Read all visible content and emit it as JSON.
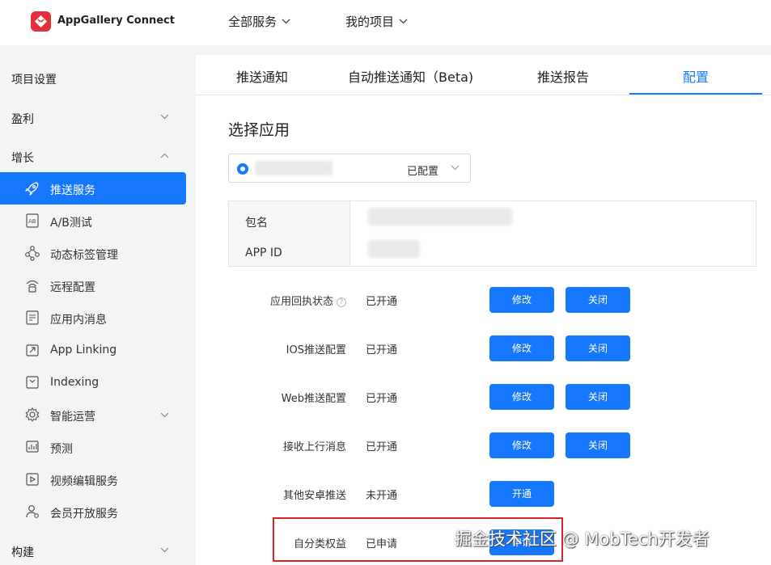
{
  "header": {
    "app_name": "AppGallery Connect",
    "nav": [
      {
        "label": "全部服务"
      },
      {
        "label": "我的项目"
      }
    ]
  },
  "sidebar": {
    "sections": {
      "project_settings": "项目设置",
      "profit": "盈利",
      "growth": "增长",
      "build": "构建"
    },
    "items": [
      {
        "label": "推送服务",
        "icon": "rocket-icon",
        "active": true
      },
      {
        "label": "A/B测试",
        "icon": "ab-test-icon"
      },
      {
        "label": "动态标签管理",
        "icon": "tag-network-icon"
      },
      {
        "label": "远程配置",
        "icon": "remote-config-icon"
      },
      {
        "label": "应用内消息",
        "icon": "in-app-message-icon"
      },
      {
        "label": "App Linking",
        "icon": "link-icon"
      },
      {
        "label": "Indexing",
        "icon": "indexing-icon"
      },
      {
        "label": "智能运营",
        "icon": "gear-icon"
      },
      {
        "label": "预测",
        "icon": "chart-icon"
      },
      {
        "label": "视频编辑服务",
        "icon": "video-icon"
      },
      {
        "label": "会员开放服务",
        "icon": "member-icon"
      }
    ]
  },
  "tabs": [
    {
      "label": "推送通知"
    },
    {
      "label": "自动推送通知（Beta)"
    },
    {
      "label": "推送报告"
    },
    {
      "label": "配置",
      "active": true
    }
  ],
  "main": {
    "section_title": "选择应用",
    "app_select_status": "已配置",
    "info_labels": {
      "package": "包名",
      "app_id": "APP ID"
    },
    "rows": [
      {
        "label": "应用回执状态",
        "has_help": true,
        "status": "已开通",
        "buttons": [
          "修改",
          "关闭"
        ]
      },
      {
        "label": "IOS推送配置",
        "status": "已开通",
        "buttons": [
          "修改",
          "关闭"
        ]
      },
      {
        "label": "Web推送配置",
        "status": "已开通",
        "buttons": [
          "修改",
          "关闭"
        ]
      },
      {
        "label": "接收上行消息",
        "status": "已开通",
        "buttons": [
          "修改",
          "关闭"
        ]
      },
      {
        "label": "其他安卓推送",
        "status": "未开通",
        "buttons": [
          "开通"
        ]
      },
      {
        "label": "自分类权益",
        "status": "已申请",
        "buttons": [
          "申请"
        ]
      }
    ]
  },
  "watermark": "掘金技术社区 @ MobTech开发者",
  "colors": {
    "accent": "#1677ff",
    "highlight": "#d9222a",
    "logo": "#e2303c"
  }
}
